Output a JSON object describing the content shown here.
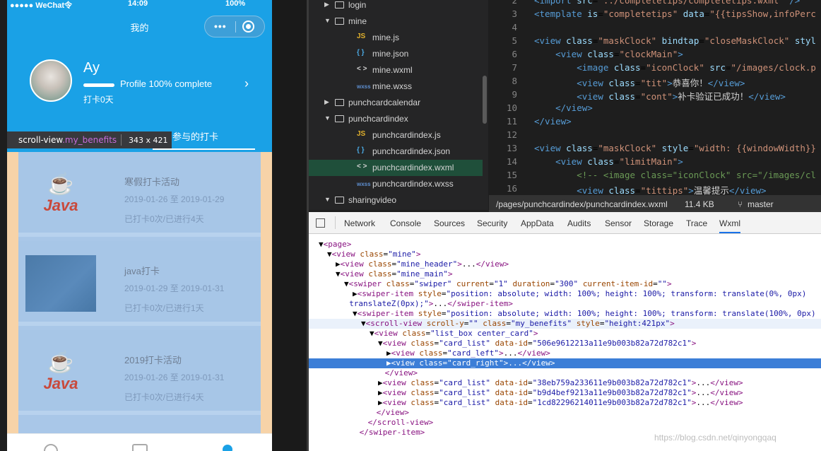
{
  "phone": {
    "status": {
      "carrier": "●●●●● WeChat令",
      "time": "14:09",
      "battery": "100%"
    },
    "nav_title": "我的",
    "capsule_dots": "•••",
    "user": {
      "name": "Ay",
      "progress_label": "Profile 100% complete",
      "progress_fraction": 1.0,
      "days": "打卡0天"
    },
    "active_tab": "参与的打卡",
    "tooltip": {
      "tag": "scroll-view",
      "class": ".my_benefits",
      "size": "343 x 421"
    },
    "cards": [
      {
        "title": "寒假打卡活动",
        "date": "2019-01-26 至 2019-01-29",
        "stat": "已打卡0次/已进行4天",
        "thumb": "java-logo"
      },
      {
        "title": "java打卡",
        "date": "2019-01-29 至 2019-01-31",
        "stat": "已打卡0次/已进行1天",
        "thumb": "blue-photo"
      },
      {
        "title": "2019打卡活动",
        "date": "2019-01-26 至 2019-01-31",
        "stat": "已打卡0次/已进行4天",
        "thumb": "java-logo"
      }
    ],
    "java_word": "Java"
  },
  "tree": [
    {
      "label": "login",
      "type": "folder",
      "open": false,
      "indent": 0
    },
    {
      "label": "mine",
      "type": "folder",
      "open": true,
      "indent": 0
    },
    {
      "label": "mine.js",
      "type": "js",
      "indent": 1
    },
    {
      "label": "mine.json",
      "type": "json",
      "indent": 1
    },
    {
      "label": "mine.wxml",
      "type": "wxml",
      "indent": 1
    },
    {
      "label": "mine.wxss",
      "type": "wxss",
      "indent": 1
    },
    {
      "label": "punchcardcalendar",
      "type": "folder",
      "open": false,
      "indent": 0
    },
    {
      "label": "punchcardindex",
      "type": "folder",
      "open": true,
      "indent": 0
    },
    {
      "label": "punchcardindex.js",
      "type": "js",
      "indent": 1
    },
    {
      "label": "punchcardindex.json",
      "type": "json",
      "indent": 1
    },
    {
      "label": "punchcardindex.wxml",
      "type": "wxml",
      "indent": 1,
      "selected": true
    },
    {
      "label": "punchcardindex.wxss",
      "type": "wxss",
      "indent": 1
    },
    {
      "label": "sharingvideo",
      "type": "folder",
      "open": true,
      "indent": 0
    }
  ],
  "tree_icons": {
    "js": "JS",
    "json": "{ }",
    "wxml": "< >",
    "wxss": "wxss"
  },
  "editor": [
    {
      "n": "2",
      "html": "<span class='tag'>&lt;import</span> <span class='attr'>src</span>=<span class='val'>\"../completetips/completetips.wxml\"</span> <span class='tag'>/&gt;</span>"
    },
    {
      "n": "3",
      "html": "<span class='tag'>&lt;template</span> <span class='attr'>is</span>=<span class='val'>\"completetips\"</span> <span class='attr'>data</span>=<span class='val'>\"{{tipsShow,infoPerc</span>"
    },
    {
      "n": "4",
      "html": ""
    },
    {
      "n": "5",
      "html": "<span class='tag'>&lt;view</span> <span class='attr'>class</span>=<span class='val'>\"maskClock\"</span> <span class='attr'>bindtap</span>=<span class='val'>\"closeMaskClock\"</span> <span class='attr'>styl</span>"
    },
    {
      "n": "6",
      "html": "    <span class='tag'>&lt;view</span> <span class='attr'>class</span>=<span class='val'>\"clockMain\"</span><span class='tag'>&gt;</span>"
    },
    {
      "n": "7",
      "html": "        <span class='tag'>&lt;image</span> <span class='attr'>class</span>=<span class='val'>\"iconClock\"</span> <span class='attr'>src</span>=<span class='val'>\"/images/clock.p</span>"
    },
    {
      "n": "8",
      "html": "        <span class='tag'>&lt;view</span> <span class='attr'>class</span>=<span class='val'>\"tit\"</span><span class='tag'>&gt;</span><span class='txt'>恭喜你！</span><span class='tag'>&lt;/view&gt;</span>"
    },
    {
      "n": "9",
      "html": "        <span class='tag'>&lt;view</span> <span class='attr'>class</span>=<span class='val'>\"cont\"</span><span class='tag'>&gt;</span><span class='txt'>补卡验证已成功！</span><span class='tag'>&lt;/view&gt;</span>"
    },
    {
      "n": "10",
      "html": "    <span class='tag'>&lt;/view&gt;</span>"
    },
    {
      "n": "11",
      "html": "<span class='tag'>&lt;/view&gt;</span>"
    },
    {
      "n": "12",
      "html": ""
    },
    {
      "n": "13",
      "html": "<span class='tag'>&lt;view</span> <span class='attr'>class</span>=<span class='val'>\"maskClock\"</span> <span class='attr'>style</span>=<span class='val'>\"width: {{windowWidth}}</span>"
    },
    {
      "n": "14",
      "html": "    <span class='tag'>&lt;view</span> <span class='attr'>class</span>=<span class='val'>\"limitMain\"</span><span class='tag'>&gt;</span>"
    },
    {
      "n": "15",
      "html": "        <span class='cmt'>&lt;!-- &lt;image class=\"iconClock\" src=\"/images/cl</span>"
    },
    {
      "n": "16",
      "html": "        <span class='tag'>&lt;view</span> <span class='attr'>class</span>=<span class='val'>\"tittips\"</span><span class='tag'>&gt;</span><span class='txt'>温馨提示</span><span class='tag'>&lt;/view&gt;</span>"
    }
  ],
  "editor_status": {
    "path": "/pages/punchcardindex/punchcardindex.wxml",
    "size": "11.4 KB",
    "branch": "master"
  },
  "devtools_tabs": [
    "Network",
    "Console",
    "Sources",
    "Security",
    "AppData",
    "Audits",
    "Sensor",
    "Storage",
    "Trace",
    "Wxml"
  ],
  "devtools_active": "Wxml",
  "dom": [
    {
      "i": 0,
      "html": "▼<span class='dt'>&lt;page&gt;</span>"
    },
    {
      "i": 1,
      "html": "▼<span class='dt'>&lt;view</span> <span class='da'>class</span>=<span class='dv'>\"mine\"</span><span class='dt'>&gt;</span>"
    },
    {
      "i": 2,
      "html": "▶<span class='dt'>&lt;view</span> <span class='da'>class</span>=<span class='dv'>\"mine_header\"</span><span class='dt'>&gt;</span>...<span class='dt'>&lt;/view&gt;</span>"
    },
    {
      "i": 2,
      "html": "▼<span class='dt'>&lt;view</span> <span class='da'>class</span>=<span class='dv'>\"mine_main\"</span><span class='dt'>&gt;</span>"
    },
    {
      "i": 3,
      "html": "▼<span class='dt'>&lt;swiper</span> <span class='da'>class</span>=<span class='dv'>\"swiper\"</span> <span class='da'>current</span>=<span class='dv'>\"1\"</span> <span class='da'>duration</span>=<span class='dv'>\"300\"</span> <span class='da'>current-item-id</span>=<span class='dv'>\"\"</span><span class='dt'>&gt;</span>"
    },
    {
      "i": 4,
      "html": "▶<span class='dt'>&lt;swiper-item</span> <span class='da'>style</span>=<span class='dv'>\"position: absolute; width: 100%; height: 100%; transform: translate(0%, 0px)</span>"
    },
    {
      "i": 3.6,
      "html": "<span class='dv'>translateZ(0px);\"</span><span class='dt'>&gt;</span>...<span class='dt'>&lt;/swiper-item&gt;</span>"
    },
    {
      "i": 4,
      "html": "▼<span class='dt'>&lt;swiper-item</span> <span class='da'>style</span>=<span class='dv'>\"position: absolute; width: 100%; height: 100%; transform: translate(100%, 0px)</span>"
    },
    {
      "i": 5,
      "html": "▼<span class='dt'>&lt;scroll-view</span> <span class='da'>scroll-y</span>=<span class='dv'>\"\"</span> <span class='da'>class</span>=<span class='dv'>\"my_benefits\"</span> <span class='da'>style</span>=<span class='dv'>\"height:421px\"</span><span class='dt'>&gt;</span>",
      "hl": true
    },
    {
      "i": 6,
      "html": "▼<span class='dt'>&lt;view</span> <span class='da'>class</span>=<span class='dv'>\"list_box center_card\"</span><span class='dt'>&gt;</span>"
    },
    {
      "i": 7,
      "html": "▼<span class='dt'>&lt;view</span> <span class='da'>class</span>=<span class='dv'>\"card_list\"</span> <span class='da'>data-id</span>=<span class='dv'>\"506e9612213a11e9b003b82a72d782c1\"</span><span class='dt'>&gt;</span>"
    },
    {
      "i": 8,
      "html": "▶<span class='dt'>&lt;view</span> <span class='da'>class</span>=<span class='dv'>\"card_left\"</span><span class='dt'>&gt;</span>...<span class='dt'>&lt;/view&gt;</span>"
    },
    {
      "i": 8,
      "html": "▶<span class='dt'>&lt;view</span> <span class='da'>class</span>=<span class='dv'>\"card_right\"</span><span class='dt'>&gt;</span>...<span class='dt'>&lt;/view&gt;</span>",
      "sel": true
    },
    {
      "i": 7.8,
      "html": "<span class='dt'>&lt;/view&gt;</span>"
    },
    {
      "i": 7,
      "html": "▶<span class='dt'>&lt;view</span> <span class='da'>class</span>=<span class='dv'>\"card_list\"</span> <span class='da'>data-id</span>=<span class='dv'>\"38eb759a233611e9b003b82a72d782c1\"</span><span class='dt'>&gt;</span>...<span class='dt'>&lt;/view&gt;</span>"
    },
    {
      "i": 7,
      "html": "▶<span class='dt'>&lt;view</span> <span class='da'>class</span>=<span class='dv'>\"card_list\"</span> <span class='da'>data-id</span>=<span class='dv'>\"b9d4bef9213a11e9b003b82a72d782c1\"</span><span class='dt'>&gt;</span>...<span class='dt'>&lt;/view&gt;</span>"
    },
    {
      "i": 7,
      "html": "▶<span class='dt'>&lt;view</span> <span class='da'>class</span>=<span class='dv'>\"card_list\"</span> <span class='da'>data-id</span>=<span class='dv'>\"1cd82296214011e9b003b82a72d782c1\"</span><span class='dt'>&gt;</span>...<span class='dt'>&lt;/view&gt;</span>"
    },
    {
      "i": 6.8,
      "html": "<span class='dt'>&lt;/view&gt;</span>"
    },
    {
      "i": 5.8,
      "html": "<span class='dt'>&lt;/scroll-view&gt;</span>"
    },
    {
      "i": 4.8,
      "html": "<span class='dt'>&lt;/swiper-item&gt;</span>"
    }
  ],
  "watermark": "https://blog.csdn.net/qinyongqaq"
}
